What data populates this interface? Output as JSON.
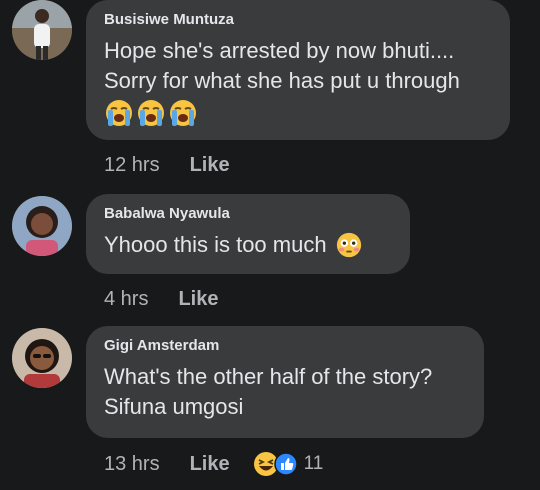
{
  "comments": [
    {
      "author": "Busisiwe Muntuza",
      "text": "Hope she's arrested by now bhuti....\nSorry for what she has put u through",
      "emoji": [
        "loudly-crying-face",
        "loudly-crying-face",
        "loudly-crying-face"
      ],
      "time": "12 hrs",
      "like_label": "Like"
    },
    {
      "author": "Babalwa Nyawula",
      "text": "Yhooo this is too much",
      "emoji": [
        "flushed-face"
      ],
      "time": "4 hrs",
      "like_label": "Like"
    },
    {
      "author": "Gigi Amsterdam",
      "text": "What's the other half of the story?\nSifuna umgosi",
      "time": "13 hrs",
      "like_label": "Like",
      "reactions": {
        "icons": [
          "haha-icon",
          "like-icon"
        ],
        "count": "11"
      }
    }
  ],
  "colors": {
    "background": "#18191a",
    "bubble": "#3a3b3c",
    "text": "#e4e6eb",
    "meta": "#b0b3b8",
    "like_blue": "#2d88ff",
    "emoji_yellow": "#f7c542"
  }
}
